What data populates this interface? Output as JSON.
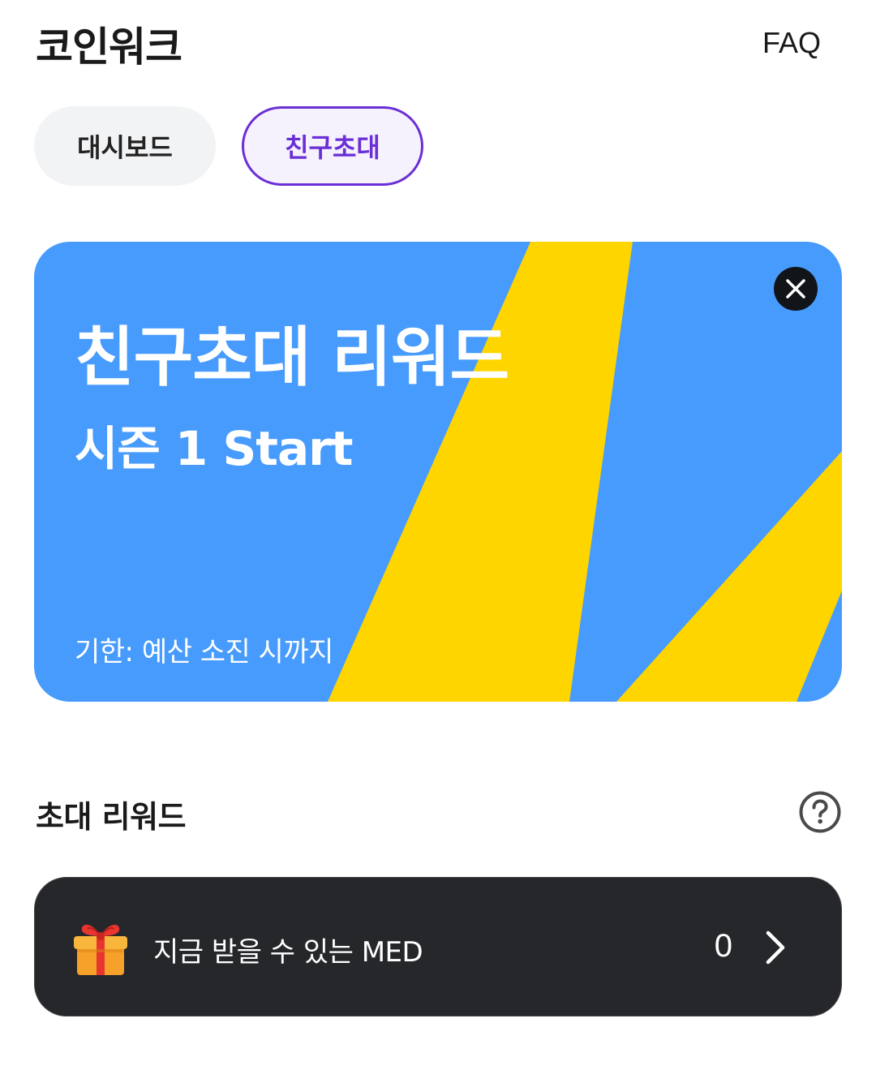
{
  "header": {
    "app_title": "코인워크",
    "faq_label": "FAQ"
  },
  "tabs": [
    {
      "label": "대시보드",
      "active": false
    },
    {
      "label": "친구초대",
      "active": true
    }
  ],
  "banner": {
    "title": "친구초대 리워드",
    "subtitle": "시즌 1 Start",
    "deadline": "기한: 예산 소진 시까지",
    "close_icon": "close-icon",
    "colors": {
      "background": "#479bfd",
      "stripe": "#ffd500"
    }
  },
  "rewards_section": {
    "title": "초대 리워드",
    "help_icon": "question-circle-icon"
  },
  "reward_card": {
    "icon": "gift-icon",
    "label": "지금 받을 수 있는 MED",
    "value": "0",
    "chevron_icon": "chevron-right-icon"
  },
  "colors": {
    "accent": "#6b2fd6",
    "card_dark": "#26272b"
  }
}
